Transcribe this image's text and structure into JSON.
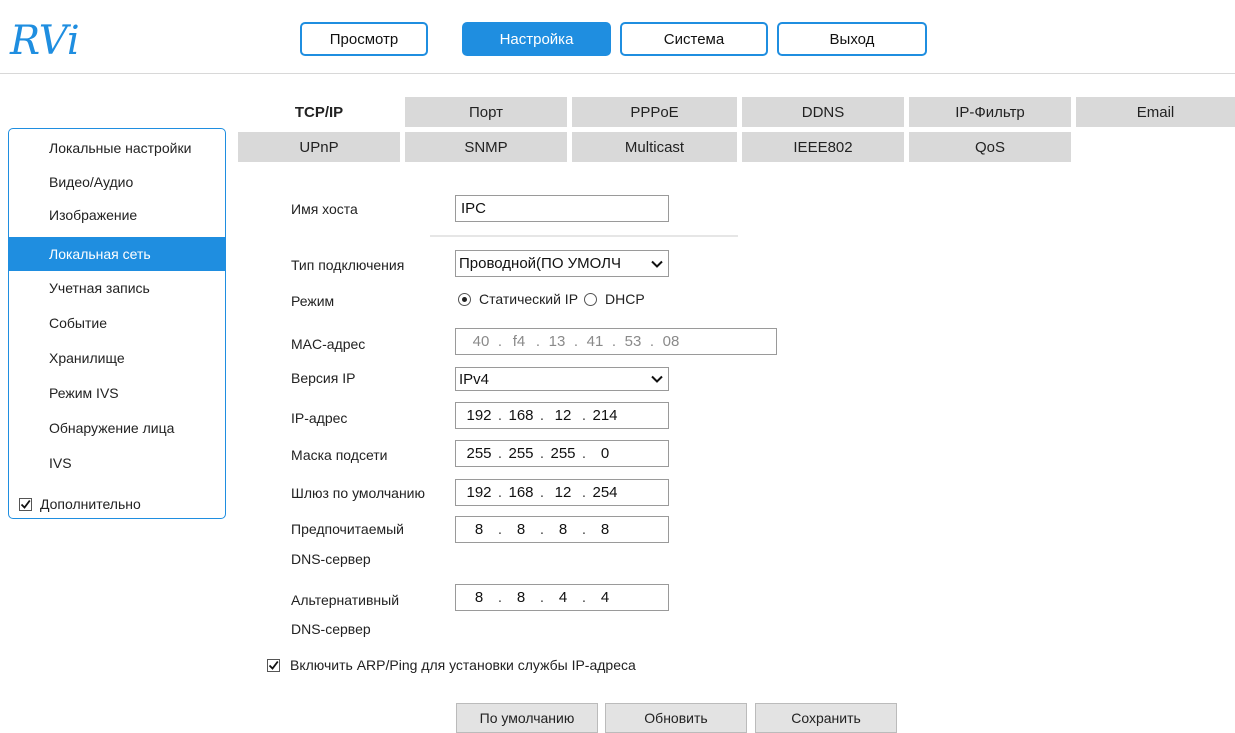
{
  "brand": {
    "logo_text": "RVi",
    "color": "#1f8ee0"
  },
  "nav": {
    "items": [
      "Просмотр",
      "Настройка",
      "Система",
      "Выход"
    ],
    "active": "Настройка"
  },
  "sidebar": {
    "items": [
      "Локальные настройки",
      "Видео/Аудио",
      "Изображение",
      "Локальная сеть",
      "Учетная запись",
      "Событие",
      "Хранилище",
      "Режим IVS",
      "Обнаружение лица",
      "IVS"
    ],
    "active": "Локальная сеть",
    "advanced_label": "Дополнительно",
    "advanced_checked": true
  },
  "tabs": {
    "row1": [
      "TCP/IP",
      "Порт",
      "PPPoE",
      "DDNS",
      "IP-Фильтр",
      "Email"
    ],
    "row2": [
      "UPnP",
      "SNMP",
      "Multicast",
      "IEEE802",
      "QoS"
    ],
    "active": "TCP/IP"
  },
  "form": {
    "hostname_label": "Имя хоста",
    "hostname_value": "IPC",
    "conn_type_label": "Тип подключения",
    "conn_type_value": "Проводной(ПО УМОЛЧ",
    "mode_label": "Режим",
    "mode_static": "Статический IP",
    "mode_dhcp": "DHCP",
    "mode_selected": "static",
    "mac_label": "MAC-адрес",
    "mac": [
      "40",
      "f4",
      "13",
      "41",
      "53",
      "08"
    ],
    "ipver_label": "Версия IP",
    "ipver_value": "IPv4",
    "ip_label": "IP-адрес",
    "ip": [
      "192",
      "168",
      "12",
      "214"
    ],
    "mask_label": "Маска подсети",
    "mask": [
      "255",
      "255",
      "255",
      "0"
    ],
    "gw_label": "Шлюз по умолчанию",
    "gw": [
      "192",
      "168",
      "12",
      "254"
    ],
    "dns1_label_1": "Предпочитаемый",
    "dns1_label_2": "DNS-сервер",
    "dns1": [
      "8",
      "8",
      "8",
      "8"
    ],
    "dns2_label_1": "Альтернативный",
    "dns2_label_2": "DNS-сервер",
    "dns2": [
      "8",
      "8",
      "4",
      "4"
    ],
    "arp_label": "Включить ARP/Ping для установки службы IP-адреса",
    "arp_checked": true
  },
  "buttons": {
    "default": "По умолчанию",
    "refresh": "Обновить",
    "save": "Сохранить"
  }
}
